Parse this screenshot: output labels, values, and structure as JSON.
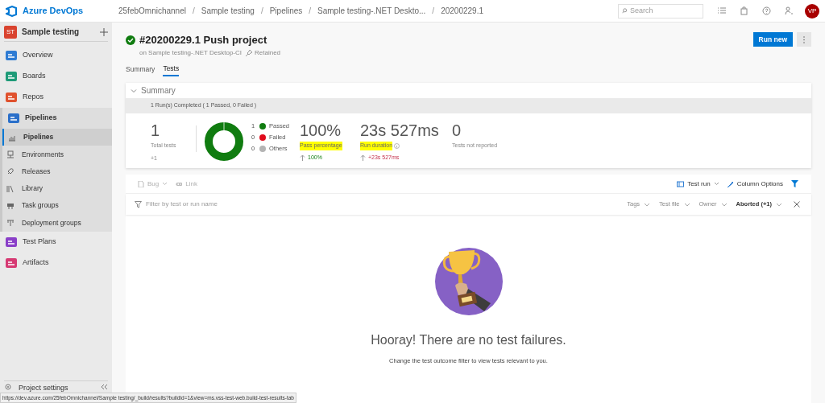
{
  "topbar": {
    "product": "Azure DevOps",
    "separator": "/",
    "breadcrumbs": [
      "25febOmnichannel",
      "Sample testing",
      "Pipelines",
      "Sample testing-.NET Deskto...",
      "20200229.1"
    ],
    "search": {
      "placeholder": "Search"
    },
    "avatar": "VP"
  },
  "sidebar": {
    "project": {
      "initials": "ST",
      "name": "Sample testing"
    },
    "items": [
      {
        "label": "Overview",
        "selected": false
      },
      {
        "label": "Boards",
        "selected": false
      },
      {
        "label": "Repos",
        "selected": false
      },
      {
        "label": "Pipelines",
        "selected": false,
        "expanded": true,
        "children": [
          {
            "label": "Pipelines",
            "selected": true
          },
          {
            "label": "Environments",
            "selected": false
          },
          {
            "label": "Releases",
            "selected": false
          },
          {
            "label": "Library",
            "selected": false
          },
          {
            "label": "Task groups",
            "selected": false
          },
          {
            "label": "Deployment groups",
            "selected": false
          }
        ]
      },
      {
        "label": "Test Plans",
        "selected": false
      },
      {
        "label": "Artifacts",
        "selected": false
      }
    ],
    "footer": "Project settings"
  },
  "header": {
    "title": "#20200229.1 Push project",
    "subtitle": "on Sample testing-.NET Desktop-CI",
    "retained": "Retained",
    "primary_button": "Run new"
  },
  "tabs": [
    {
      "label": "Summary",
      "selected": false
    },
    {
      "label": "Tests",
      "selected": true
    }
  ],
  "summary": {
    "title": "Summary",
    "expanded": true,
    "band": "1 Run(s) Completed ( 1 Passed, 0 Failed )",
    "total": {
      "value": "1",
      "label": "Total tests",
      "delta": "+1"
    },
    "legend": [
      {
        "count": "1",
        "label": "Passed",
        "color": "#107c10"
      },
      {
        "count": "0",
        "label": "Failed",
        "color": "#e00b1c"
      },
      {
        "count": "0",
        "label": "Others",
        "color": "#b4b4b4"
      }
    ],
    "metrics": [
      {
        "value": "100%",
        "label": "Pass percentage",
        "highlighted": true,
        "delta": "100%",
        "positive": true
      },
      {
        "value": "23s 527ms",
        "label": "Run duration",
        "highlighted": true,
        "info": true,
        "delta": "+23s 527ms",
        "positive": false
      },
      {
        "value": "0",
        "label": "Tests not reported",
        "highlighted": false
      }
    ]
  },
  "toolbar": {
    "left": [
      {
        "label": "Bug",
        "disabled": true
      },
      {
        "label": "Link",
        "disabled": true
      }
    ],
    "right": [
      {
        "label": "Test run"
      },
      {
        "label": "Column Options"
      }
    ]
  },
  "filter": {
    "placeholder": "Filter by test or run name",
    "dropdowns": [
      {
        "label": "Tags",
        "active": false
      },
      {
        "label": "Test file",
        "active": false
      },
      {
        "label": "Owner",
        "active": false
      },
      {
        "label": "Aborted (+1)",
        "active": true
      }
    ]
  },
  "empty_state": {
    "title": "Hooray! There are no test failures.",
    "message": "Change the test outcome filter to view tests relevant to you."
  },
  "status_url": "https://dev.azure.com/25febOmnichannel/Sample testing/_build/results?buildId=1&view=ms.vss-test-web.build-test-results-tab"
}
